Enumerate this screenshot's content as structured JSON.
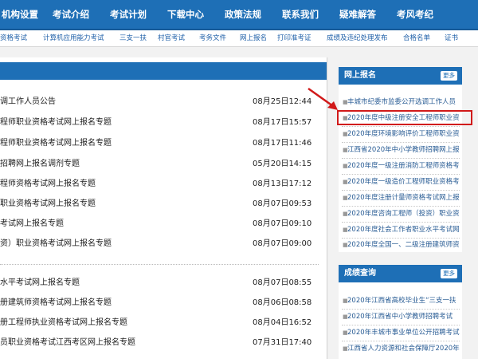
{
  "topnav": {
    "items": [
      "机构设置",
      "考试介绍",
      "考试计划",
      "下载中心",
      "政策法规",
      "联系我们",
      "疑难解答",
      "考风考纪"
    ]
  },
  "subnav": {
    "items": [
      "资格考试",
      "计算机应用能力考试",
      "三支一扶",
      "村官考试",
      "考务文件",
      "网上报名",
      "打印准考证",
      "成绩及违纪处理发布",
      "合格名单",
      "证书"
    ]
  },
  "main_list": {
    "rows": [
      {
        "title": "调工作人员公告",
        "date": "08月25日12:44"
      },
      {
        "title": "程师职业资格考试网上报名专题",
        "date": "08月17日15:57"
      },
      {
        "title": "程师职业资格考试网上报名专题",
        "date": "08月17日11:46"
      },
      {
        "title": "招聘网上报名调剂专题",
        "date": "05月20日14:15"
      },
      {
        "title": "程师资格考试网上报名专题",
        "date": "08月13日17:12"
      },
      {
        "title": "职业资格考试网上报名专题",
        "date": "08月07日09:53"
      },
      {
        "title": "考试网上报名专题",
        "date": "08月07日09:10"
      },
      {
        "title": "资）职业资格考试网上报名专题",
        "date": "08月07日09:00"
      },
      {
        "title": "水平考试网上报名专题",
        "date": "08月07日08:55"
      },
      {
        "title": "册建筑师资格考试网上报名专题",
        "date": "08月06日08:58"
      },
      {
        "title": "册工程师执业资格考试网上报名专题",
        "date": "08月04日16:52"
      },
      {
        "title": "员职业资格考试江西考区网上报名专题",
        "date": "07月31日17:40"
      }
    ]
  },
  "online_signup": {
    "title": "网上报名",
    "more": "更多",
    "items": [
      "丰城市纪委市监委公开选调工作人员",
      "2020年度中级注册安全工程师职业资",
      "2020年度环境影响评价工程师职业资",
      "江西省2020年中小学教师招聘网上报",
      "2020年度一级注册消防工程师资格考",
      "2020年度一级造价工程师职业资格考",
      "2020年度注册计量师资格考试网上报",
      "2020年度咨询工程师（投资）职业资",
      "2020年度社会工作者职业水平考试网",
      "2020年度全国一、二级注册建筑师资"
    ]
  },
  "score_query": {
    "title": "成绩查询",
    "more": "更多",
    "items": [
      "2020年江西省高校毕业生“三支一扶",
      "2020年江西省中小学教师招聘考试",
      "2020年丰城市事业单位公开招聘考试",
      "江西省人力资源和社会保障厅2020年"
    ]
  },
  "colors": {
    "nav": "#1e6fb6",
    "link": "#1e5fa8",
    "highlight": "#d11a1a"
  }
}
